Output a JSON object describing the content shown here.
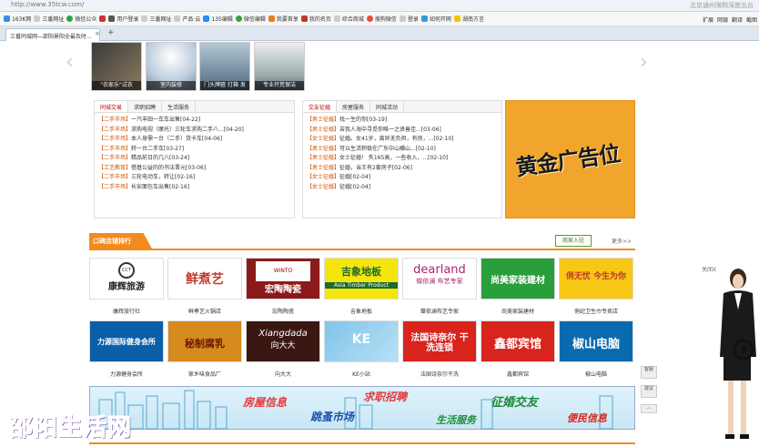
{
  "browser": {
    "url": "http://www.35tcw.com/",
    "location_hint": "北京通州限购深度出台",
    "bookmarks": [
      "163K网",
      "三番网址",
      "微信公众",
      "",
      "用户登录",
      "三番网址",
      "产品·云",
      "135编辑",
      "微信编辑",
      "我要首享",
      "我的名页",
      "综合商城",
      "搜狗微信",
      "登录",
      "如何开网",
      "湖南方言"
    ],
    "toolbar": [
      "扩展",
      "网银",
      "翻译",
      "截图"
    ],
    "tab_title": "三番同城网—邵阳景阳全最及时..."
  },
  "photos": [
    {
      "caption": "\"衣家乐\"试衣"
    },
    {
      "caption": "室内装修"
    },
    {
      "caption": "门头牌匾 灯箱 发"
    },
    {
      "caption": "专业开荒保洁"
    }
  ],
  "panel_left": {
    "tabs": [
      "同城交易",
      "求职招聘",
      "生活服务"
    ],
    "rows": [
      {
        "tag": "【二手市场】",
        "text": "一汽丰田一车车出售",
        "date": "[04-22]"
      },
      {
        "tag": "【二手市场】",
        "text": "求购电视（摩托）三轮车求购二手八...",
        "date": "[04-20]"
      },
      {
        "tag": "【二手市场】",
        "text": "本人身需一台（二手）货卡车",
        "date": "[04-06]"
      },
      {
        "tag": "【二手市场】",
        "text": "转一台二手车",
        "date": "[03-27]"
      },
      {
        "tag": "【二手市场】",
        "text": "精品前日的几八",
        "date": "[03-24]"
      },
      {
        "tag": "【工艺教育】",
        "text": "借基公益的的书法晋元",
        "date": "[03-06]"
      },
      {
        "tag": "【二手市场】",
        "text": "三轮电动车，转让",
        "date": "[02-16]"
      },
      {
        "tag": "【二手市场】",
        "text": "长安面包车出售",
        "date": "[02-16]"
      }
    ]
  },
  "panel_mid": {
    "tabs": [
      "交友征婚",
      "房屋服务",
      "同城活动"
    ],
    "rows": [
      {
        "tag": "【男士征婚】",
        "text": "找一生的你",
        "date": "[03-19]"
      },
      {
        "tag": "【男士征婚】",
        "text": "苦我人海中寻觅你唯一之贤善佳...",
        "date": "[03-06]"
      },
      {
        "tag": "【女士征婚】",
        "text": "征婚。女41岁，离异无负担，有房，...",
        "date": "[02-10]"
      },
      {
        "tag": "【男士征婚】",
        "text": "可以生活积极在广东中山横山...",
        "date": "[02-10]"
      },
      {
        "tag": "【男士征婚】",
        "text": "女士征婚！ 失165高，一些收入，...",
        "date": "[02-10]"
      },
      {
        "tag": "【男士征婚】",
        "text": "征婚，当王有2套房子",
        "date": "[02-06]"
      },
      {
        "tag": "【女士征婚】",
        "text": "征婚",
        "date": "[02-04]"
      },
      {
        "tag": "【女士征婚】",
        "text": "征婚",
        "date": "[02-04]"
      }
    ]
  },
  "ad": {
    "text": "黄金广告位"
  },
  "section": {
    "title": "口碑店铺排行",
    "settle": "商家入驻",
    "more": "更多>>"
  },
  "shops_row1": [
    {
      "logo": "康辉旅游",
      "name": "康辉旅行社"
    },
    {
      "logo": "鲜煮艺",
      "name": "鲜煮艺火锅店"
    },
    {
      "logo": "宏陶陶瓷",
      "name": "宏陶陶瓷"
    },
    {
      "logo": "吉象地板",
      "sub": "Asia Timber Product",
      "name": "吉象地板"
    },
    {
      "logo": "dearland",
      "sub": "蝶依澜 布艺专家",
      "name": "蝶依澜布艺专家"
    },
    {
      "logo": "尚美家装建材",
      "name": "尚美家装建材"
    },
    {
      "logo": "俏无忧 今生为你",
      "name": "俏妃卫生巾专卖店"
    }
  ],
  "shops_row2": [
    {
      "logo": "力源国际健身会所",
      "name": "力源健身会所"
    },
    {
      "logo": "秘制腐乳",
      "name": "家乡味食品厂"
    },
    {
      "logo": "向大大",
      "sub": "Xiangdada",
      "name": "向大大"
    },
    {
      "logo": "KE",
      "name": "KE小站"
    },
    {
      "logo": "法国诗奈尔 干洗连锁",
      "name": "法国诗奈尔干洗"
    },
    {
      "logo": "鑫都宾馆",
      "name": "鑫都宾馆"
    },
    {
      "logo": "椒山电脑",
      "name": "椒山电脑"
    }
  ],
  "banner": {
    "items": [
      "房屋信息",
      "求职招聘",
      "跳蚤市场",
      "生活服务",
      "征婚交友",
      "便民信息"
    ]
  },
  "watermark": "邵阳生活网",
  "side": {
    "close": "关闭X",
    "b1": "客服",
    "b2": "建议"
  },
  "colors": {
    "accent": "#f38b1c",
    "tag": "#d35400",
    "ad_bg": "#f2a52c"
  }
}
